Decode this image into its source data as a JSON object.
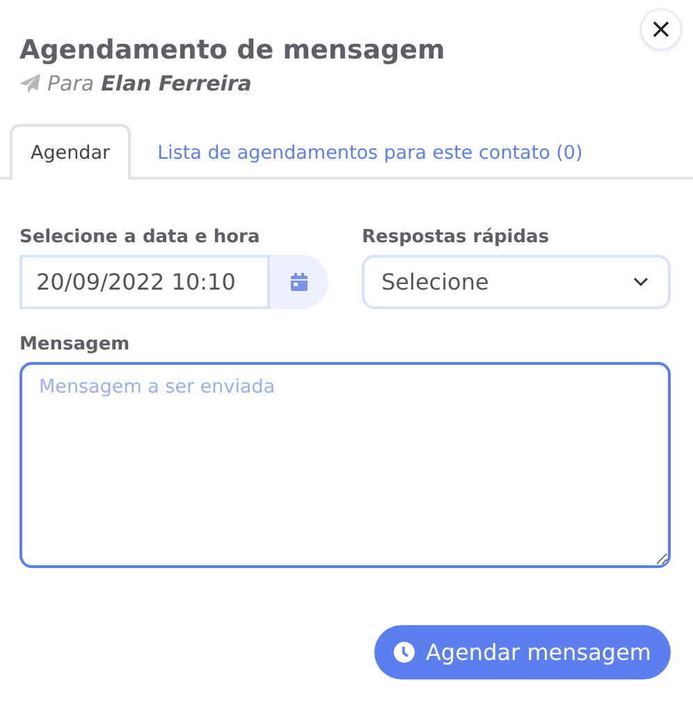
{
  "dialog": {
    "title": "Agendamento de mensagem",
    "recipient_prefix": "Para",
    "recipient_name": "Elan Ferreira"
  },
  "tabs": [
    {
      "label": "Agendar",
      "selected": true
    },
    {
      "label": "Lista de agendamentos para este contato (0)",
      "selected": false
    }
  ],
  "date_field": {
    "label": "Selecione a data e hora",
    "value": "20/09/2022 10:10"
  },
  "quick_replies": {
    "label": "Respostas rápidas",
    "value": "Selecione"
  },
  "message": {
    "label": "Mensagem",
    "placeholder": "Mensagem a ser enviada",
    "focused": true
  },
  "submit_button": {
    "label": "Agendar mensagem"
  }
}
